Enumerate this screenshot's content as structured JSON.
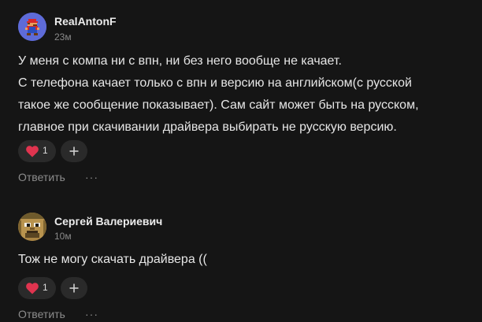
{
  "comments": [
    {
      "author": "RealAntonF",
      "time": "23м",
      "lines": [
        "У меня с компа ни с впн, ни без него вообще не качает.",
        "С телефона качает только с впн и версию на английском(с русской",
        "такое же сообщение показывает). Сам сайт может быть на русском,",
        "главное при скачивании драйвера выбирать не русскую версию."
      ],
      "likes": "1",
      "reply_label": "Ответить",
      "more_label": "···"
    },
    {
      "author": "Сергей Валериевич",
      "time": "10м",
      "lines": [
        "Тож не могу скачать драйвера (("
      ],
      "likes": "1",
      "reply_label": "Ответить",
      "more_label": "···"
    }
  ],
  "colors": {
    "background": "#151515",
    "pill": "#2a2a2a",
    "heart": "#e0344f",
    "muted": "#8c8c8c"
  },
  "icons": [
    "heart-icon",
    "plus-icon",
    "more-icon"
  ]
}
